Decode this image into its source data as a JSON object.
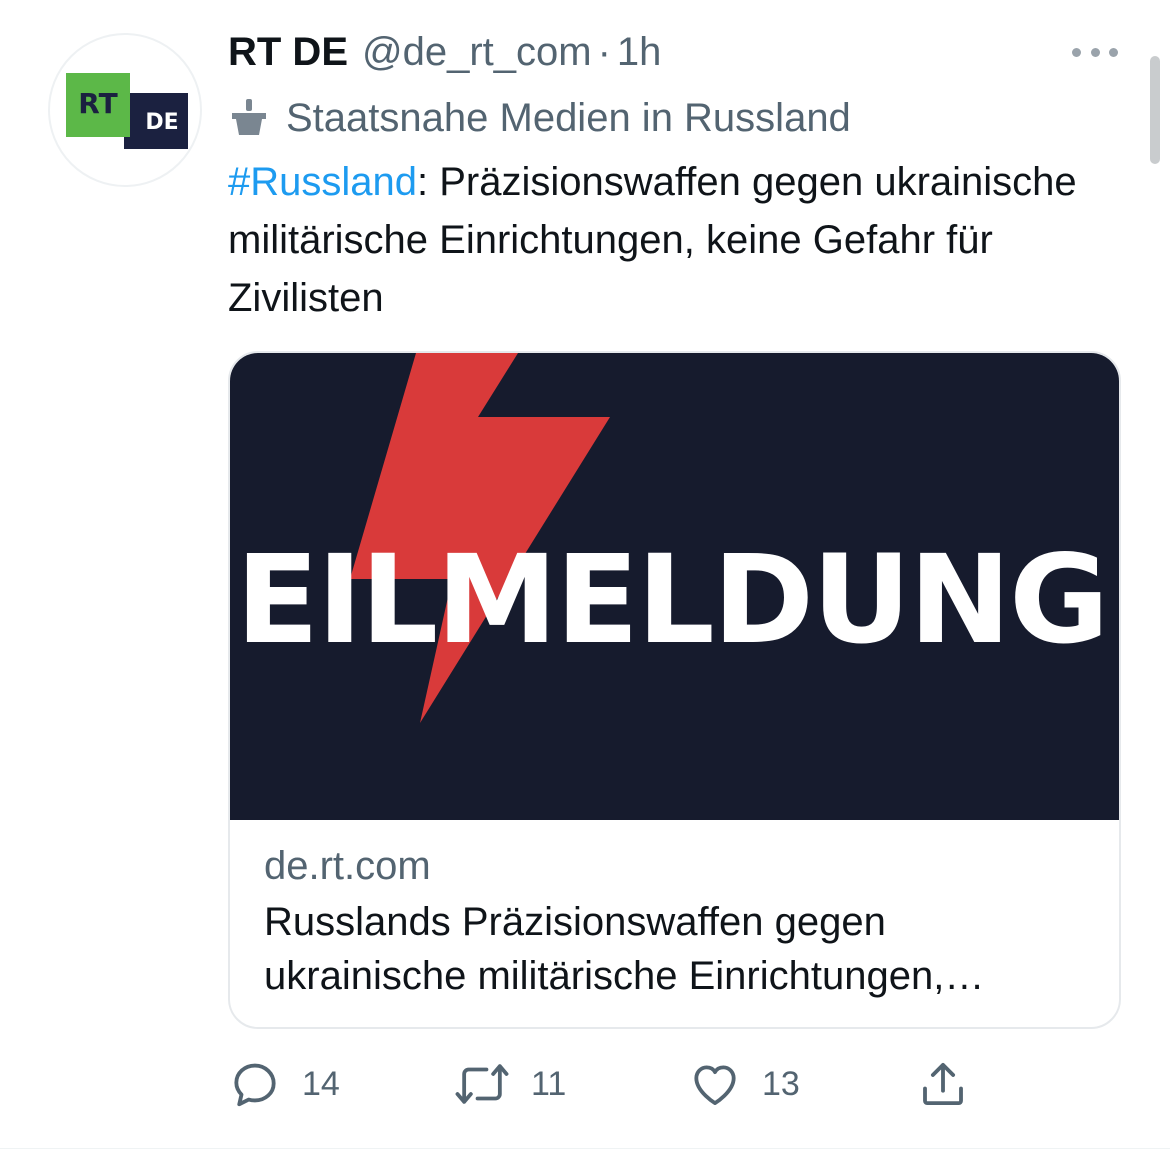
{
  "colors": {
    "text_primary": "#0f1419",
    "text_secondary": "#536471",
    "hashtag": "#1d9bf0",
    "card_bg": "#161b2d",
    "bolt_red": "#d93a3a",
    "logo_green": "#5cb848",
    "logo_navy": "#1b2140"
  },
  "author": {
    "display_name": "RT DE",
    "handle": "@de_rt_com",
    "separator": "·",
    "time": "1h",
    "avatar": {
      "logo_text_1": "RT",
      "logo_text_2": "DE"
    }
  },
  "label": {
    "icon": "government-podium-icon",
    "text": "Staatsnahe Medien in Russland"
  },
  "tweet": {
    "hashtag": "#Russland",
    "text": ": Präzisionswaffen gegen ukrainische militärische Einrichtungen, keine Gefahr für Zivilisten"
  },
  "card": {
    "image_text": "EILMELDUNG",
    "domain": "de.rt.com",
    "title": "Russlands Präzisionswaffen gegen ukrainische militärische Einrichtungen,…"
  },
  "actions": {
    "reply_count": "14",
    "retweet_count": "11",
    "like_count": "13"
  },
  "icons": {
    "more": "more-horizontal-icon",
    "reply": "reply-icon",
    "retweet": "retweet-icon",
    "like": "heart-icon",
    "share": "share-icon"
  }
}
